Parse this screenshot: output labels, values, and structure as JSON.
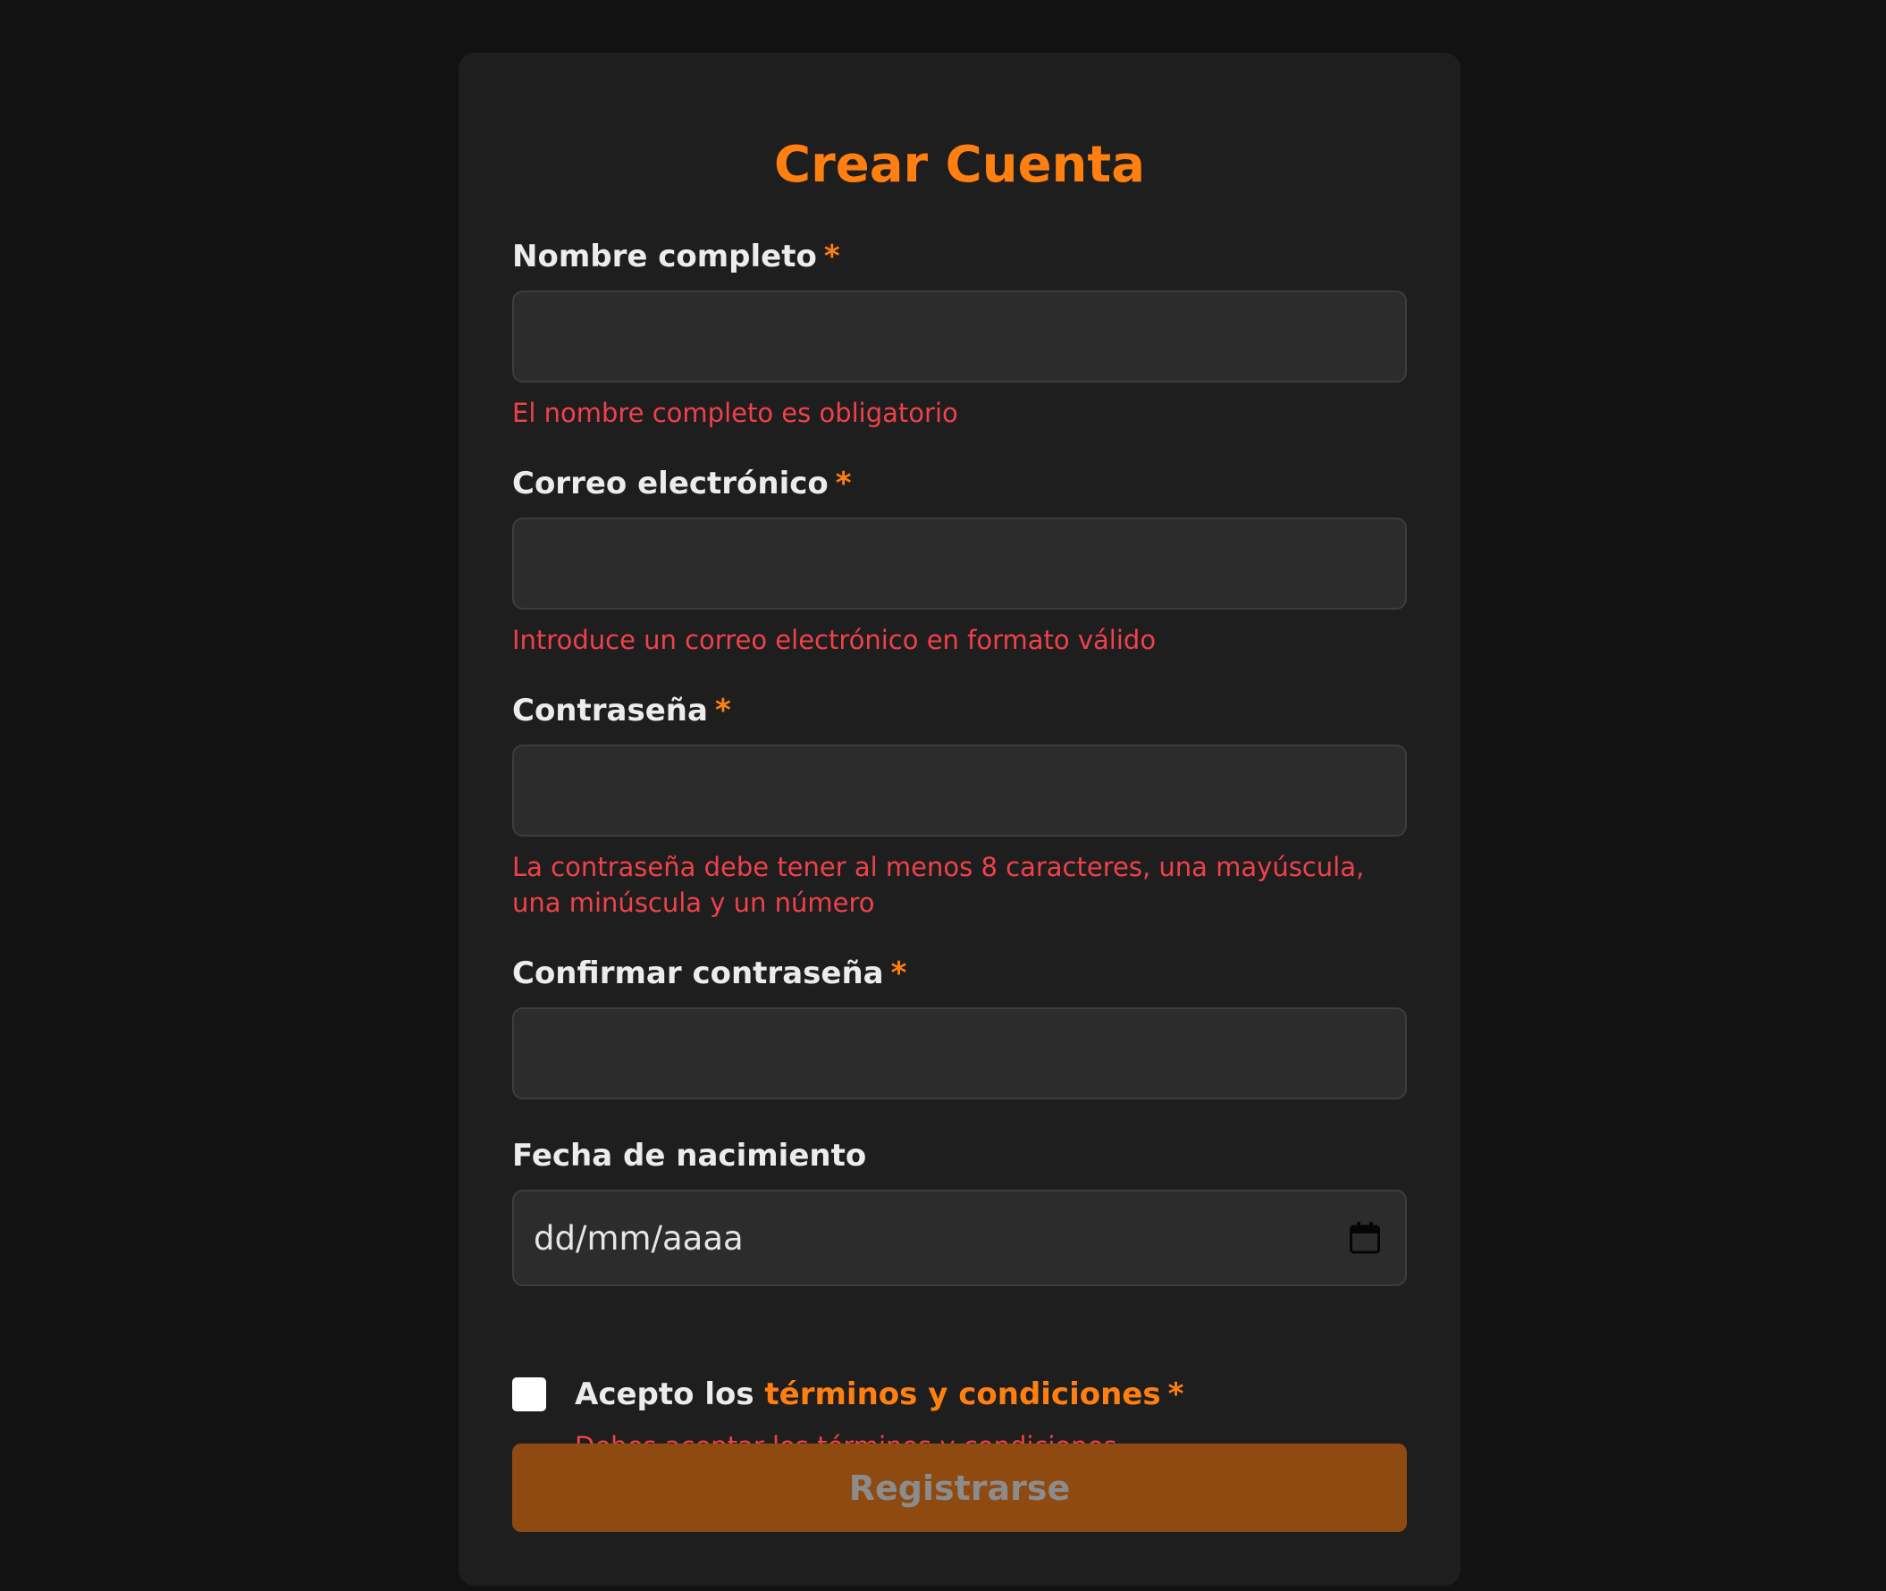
{
  "form": {
    "title": "Crear Cuenta",
    "required_marker": "*",
    "fields": {
      "full_name": {
        "label": "Nombre completo",
        "value": "",
        "error": "El nombre completo es obligatorio"
      },
      "email": {
        "label": "Correo electrónico",
        "value": "",
        "error": "Introduce un correo electrónico en formato válido"
      },
      "password": {
        "label": "Contraseña",
        "value": "",
        "error": "La contraseña debe tener al menos 8 caracteres, una mayúscula, una minúscula y un número"
      },
      "confirm_password": {
        "label": "Confirmar contraseña",
        "value": ""
      },
      "birthdate": {
        "label": "Fecha de nacimiento",
        "placeholder": "dd/mm/aaaa",
        "icon": "calendar-icon"
      }
    },
    "terms": {
      "prefix": "Acepto los",
      "link": "términos y condiciones",
      "checked": false,
      "error": "Debes aceptar los términos y condiciones"
    },
    "submit_label": "Registrarse"
  },
  "colors": {
    "page_background": "#121212",
    "card_background": "#1e1e1e",
    "accent": "#ff7f11",
    "error": "#f0414a",
    "input_background": "#2c2c2c",
    "button_background": "#8f4a12"
  }
}
